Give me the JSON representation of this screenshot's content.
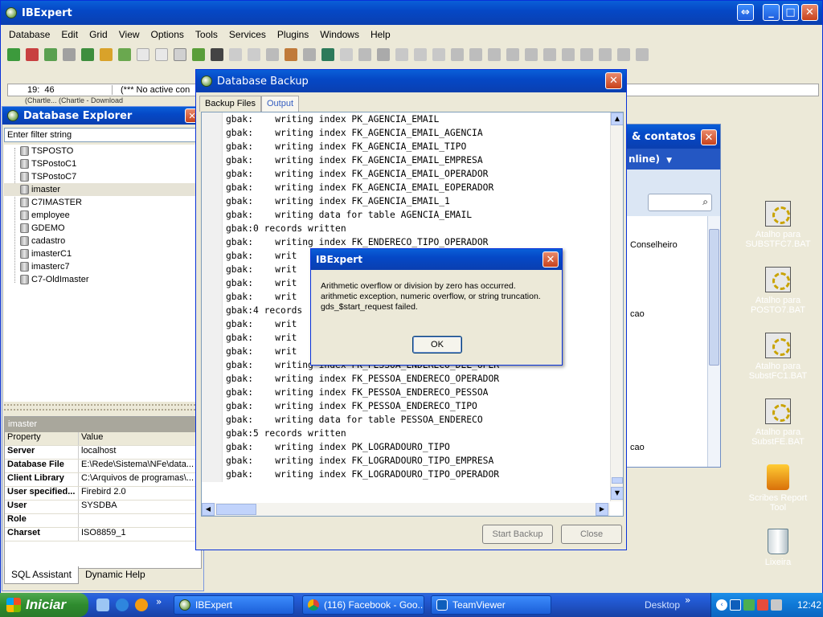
{
  "main_window": {
    "title": "IBExpert",
    "menu": [
      "Database",
      "Edit",
      "Grid",
      "View",
      "Options",
      "Tools",
      "Services",
      "Plugins",
      "Windows",
      "Help"
    ],
    "status_pos": "19:  46",
    "status_text": "(*** No active con",
    "strip_text": "(Chartle... (Chartle - Download"
  },
  "db_explorer": {
    "title": "Database Explorer",
    "filter_placeholder": "Enter filter string",
    "items": [
      "TSPOSTO",
      "TSPostoC1",
      "TSPostoC7",
      "imaster",
      "C7IMASTER",
      "employee",
      "GDEMO",
      "cadastro",
      "imasterC1",
      "imasterc7",
      "C7-OldImaster"
    ],
    "selected_index": 3,
    "props_title": "imaster",
    "col_property": "Property",
    "col_value": "Value",
    "props": [
      {
        "k": "Server",
        "v": "localhost"
      },
      {
        "k": "Database File",
        "v": "E:\\Rede\\Sistema\\NFe\\data..."
      },
      {
        "k": "Client Library",
        "v": "C:\\Arquivos de programas\\..."
      },
      {
        "k": "User specified...",
        "v": "Firebird 2.0"
      },
      {
        "k": "User",
        "v": "SYSDBA"
      },
      {
        "k": "Role",
        "v": ""
      },
      {
        "k": "Charset",
        "v": "ISO8859_1"
      }
    ],
    "tab_sql": "SQL Assistant",
    "tab_help": "Dynamic Help"
  },
  "backup_window": {
    "title": "Database Backup",
    "tab_files": "Backup Files",
    "tab_output": "Output",
    "lines": [
      "gbak:    writing index PK_AGENCIA_EMAIL",
      "gbak:    writing index FK_AGENCIA_EMAIL_AGENCIA",
      "gbak:    writing index FK_AGENCIA_EMAIL_TIPO",
      "gbak:    writing index FK_AGENCIA_EMAIL_EMPRESA",
      "gbak:    writing index FK_AGENCIA_EMAIL_OPERADOR",
      "gbak:    writing index FK_AGENCIA_EMAIL_EOPERADOR",
      "gbak:    writing index FK_AGENCIA_EMAIL_1",
      "gbak:    writing data for table AGENCIA_EMAIL",
      "gbak:0 records written",
      "gbak:    writing index FK_ENDERECO_TIPO_OPERADOR",
      "gbak:    writ",
      "gbak:    writ",
      "gbak:    writ",
      "gbak:    writ",
      "gbak:4 records",
      "gbak:    writ",
      "gbak:    writ",
      "gbak:    writ",
      "gbak:    writing index FK_PESSOA_ENDERECO_DEL_OPER",
      "gbak:    writing index FK_PESSOA_ENDERECO_OPERADOR",
      "gbak:    writing index FK_PESSOA_ENDERECO_PESSOA",
      "gbak:    writing index FK_PESSOA_ENDERECO_TIPO",
      "gbak:    writing data for table PESSOA_ENDERECO",
      "gbak:5 records written",
      "gbak:    writing index PK_LOGRADOURO_TIPO",
      "gbak:    writing index FK_LOGRADOURO_TIPO_EMPRESA",
      "gbak:    writing index FK_LOGRADOURO_TIPO_OPERADOR"
    ],
    "start_button": "Start Backup",
    "close_button": "Close"
  },
  "error_dialog": {
    "title": "IBExpert",
    "line1": "Arithmetic overflow or division by zero has occurred.",
    "line2": "arithmetic exception, numeric overflow, or string truncation.",
    "line3": "gds_$start_request failed.",
    "ok": "OK"
  },
  "contacts_window": {
    "title": "& contatos",
    "status": "nline)",
    "item1": "Conselheiro",
    "item2": "cao",
    "item3": "cao"
  },
  "desktop_icons": [
    {
      "label1": "Atalho para",
      "label2": "SUBSTFC7.BAT"
    },
    {
      "label1": "Atalho para",
      "label2": "POSTO7.BAT"
    },
    {
      "label1": "Atalho para",
      "label2": "SubstFC1.BAT"
    },
    {
      "label1": "Atalho para",
      "label2": "SubstFE.BAT"
    },
    {
      "label1": "Scribes Report Tool",
      "label2": ""
    },
    {
      "label1": "Lixeira",
      "label2": ""
    }
  ],
  "taskbar": {
    "start": "Iniciar",
    "btn1": "IBExpert",
    "btn2": "(116) Facebook - Goo...",
    "btn3": "TeamViewer",
    "desktop": "Desktop",
    "clock": "12:42"
  }
}
